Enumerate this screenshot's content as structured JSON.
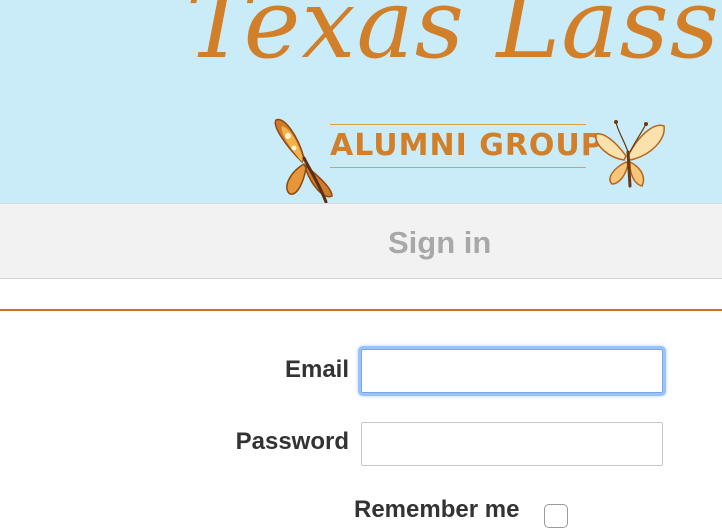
{
  "header": {
    "banner_title": "Texas Lassos",
    "banner_subtitle": "ALUMNI GROUP",
    "banner_color": "#c9ecf8",
    "accent_color": "#d27f2a",
    "icons": [
      "butterfly-icon",
      "butterfly-icon"
    ]
  },
  "signin": {
    "title": "Sign in"
  },
  "form": {
    "email_label": "Email",
    "email_value": "",
    "email_placeholder": "",
    "password_label": "Password",
    "password_value": "",
    "password_placeholder": "",
    "remember_label": "Remember me",
    "remember_checked": false
  }
}
